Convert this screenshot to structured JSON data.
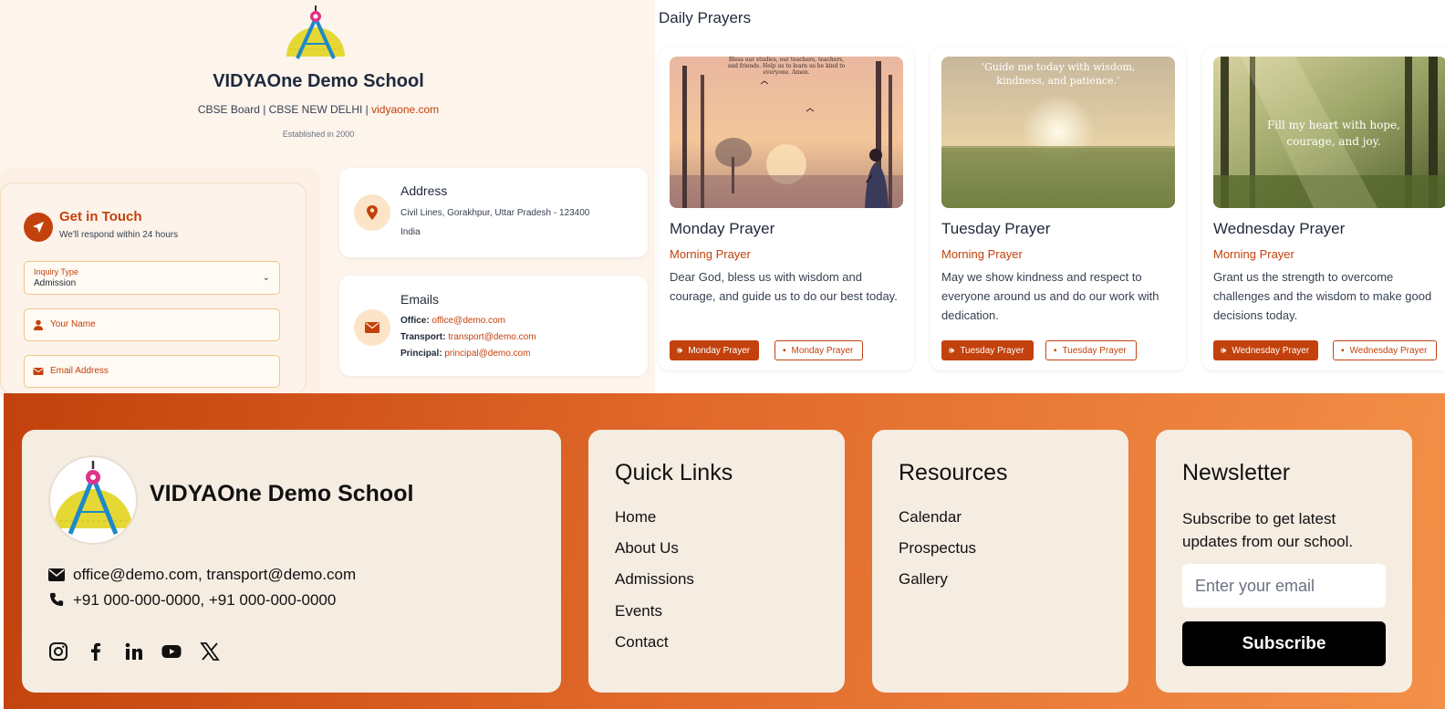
{
  "school": {
    "name": "VIDYAOne Demo School",
    "meta_prefix": "CBSE Board | CBSE NEW DELHI | ",
    "website": "vidyaone.com",
    "established": "Established in 2000"
  },
  "contact_form": {
    "title": "Get in Touch",
    "subtitle": "We'll respond within 24 hours",
    "inquiry_label": "Inquiry Type",
    "inquiry_value": "Admission",
    "name_placeholder": "Your Name",
    "email_placeholder": "Email Address"
  },
  "address": {
    "title": "Address",
    "line1": "Civil Lines, Gorakhpur, Uttar Pradesh - 123400",
    "line2": "India"
  },
  "emails": {
    "title": "Emails",
    "items": [
      {
        "label": "Office:",
        "value": "office@demo.com"
      },
      {
        "label": "Transport:",
        "value": "transport@demo.com"
      },
      {
        "label": "Principal:",
        "value": "principal@demo.com"
      }
    ]
  },
  "prayers": {
    "title": "Daily Prayers",
    "cards": [
      {
        "name": "Monday Prayer",
        "time": "Morning Prayer",
        "text": "Dear God, bless us with wisdom and courage, and guide us to do our best today.",
        "image_quote": "Bless our studies, our teachers, teachers, and friends. Help us to learn us be kind to everyone. Amen.",
        "audio_label": "Monday Prayer",
        "video_label": "Monday Prayer"
      },
      {
        "name": "Tuesday Prayer",
        "time": "Morning Prayer",
        "text": "May we show kindness and respect to everyone around us and do our work with dedication.",
        "image_quote": "‘Guide me today with wisdom, kindness, and patience.’",
        "audio_label": "Tuesday Prayer",
        "video_label": "Tuesday Prayer"
      },
      {
        "name": "Wednesday Prayer",
        "time": "Morning Prayer",
        "text": "Grant us the strength to overcome challenges and the wisdom to make good decisions today.",
        "image_quote": "Fill my heart with hope, courage, and joy.",
        "audio_label": "Wednesday Prayer",
        "video_label": "Wednesday Prayer"
      }
    ]
  },
  "footer": {
    "school_name": "VIDYAOne Demo School",
    "emails": "office@demo.com, transport@demo.com",
    "phones": "+91 000-000-0000, +91 000-000-0000",
    "social": [
      "instagram-icon",
      "facebook-icon",
      "linkedin-icon",
      "youtube-icon",
      "x-icon"
    ],
    "quick_links": {
      "title": "Quick Links",
      "items": [
        "Home",
        "About Us",
        "Admissions",
        "Events",
        "Contact"
      ]
    },
    "resources": {
      "title": "Resources",
      "items": [
        "Calendar",
        "Prospectus",
        "Gallery"
      ]
    },
    "newsletter": {
      "title": "Newsletter",
      "text": "Subscribe to get latest updates from our school.",
      "placeholder": "Enter your email",
      "button": "Subscribe"
    }
  },
  "colors": {
    "accent": "#c2410c",
    "footer_start": "#c2410c",
    "footer_end": "#f39048",
    "card_bg": "#f5ece2"
  }
}
